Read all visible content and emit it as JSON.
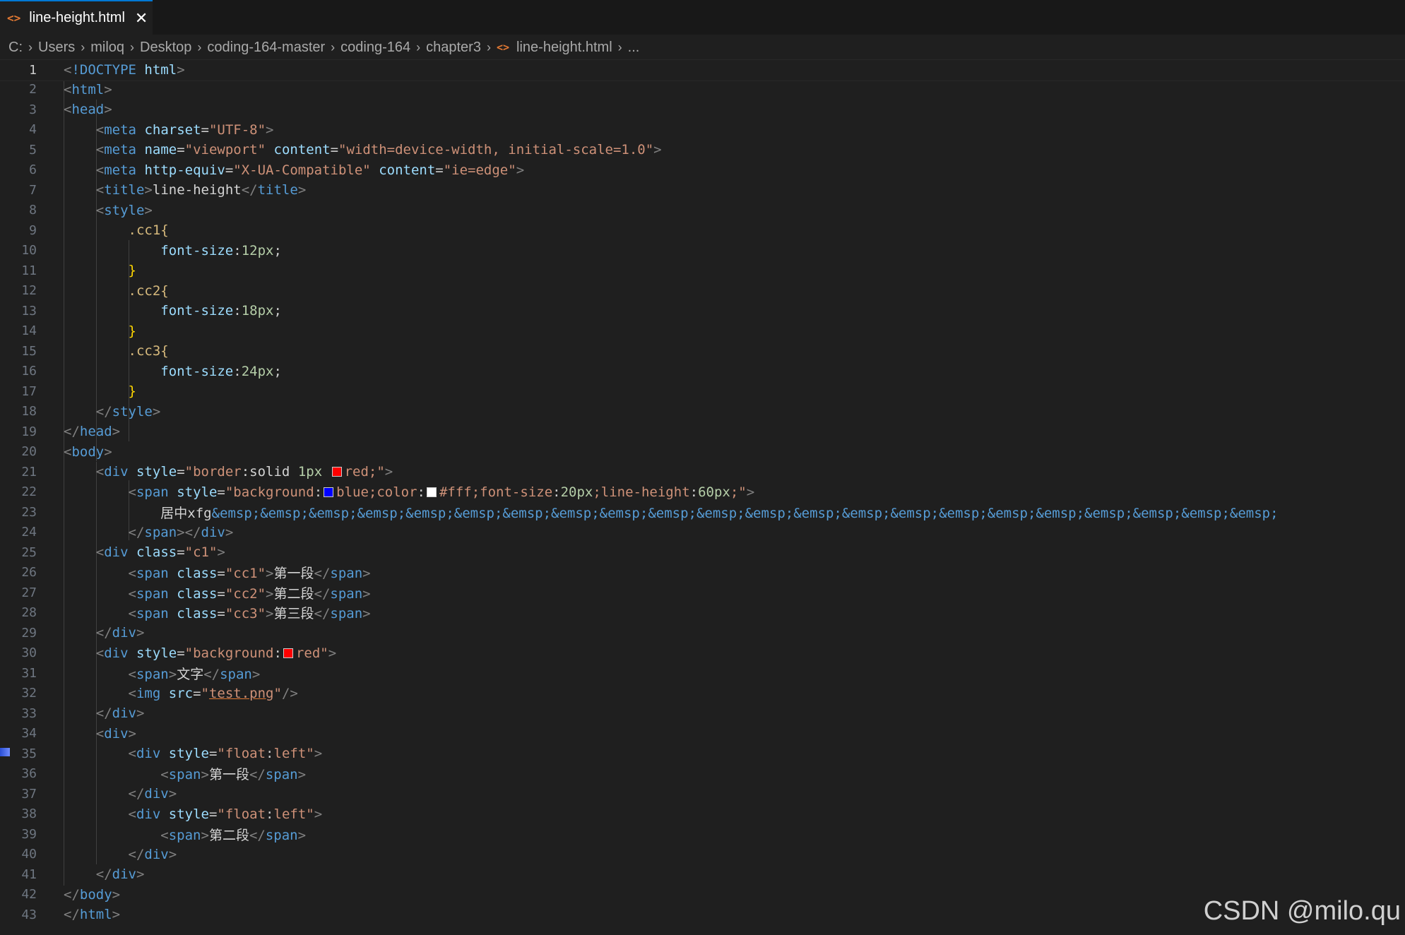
{
  "tab": {
    "icon": "html-file-icon",
    "label": "line-height.html",
    "close": "✕"
  },
  "breadcrumb": [
    "C:",
    "Users",
    "miloq",
    "Desktop",
    "coding-164-master",
    "coding-164",
    "chapter3",
    "line-height.html",
    "..."
  ],
  "colors": {
    "accent": "#0078d4",
    "html_icon": "#e37933",
    "swatch_red": "#ff0000",
    "swatch_blue": "#0000ff",
    "swatch_white": "#ffffff"
  },
  "editor": {
    "active_line": 1,
    "line_numbers": [
      "1",
      "2",
      "3",
      "4",
      "5",
      "6",
      "7",
      "8",
      "9",
      "10",
      "11",
      "12",
      "13",
      "14",
      "15",
      "16",
      "17",
      "18",
      "19",
      "20",
      "21",
      "22",
      "23",
      "24",
      "25",
      "26",
      "27",
      "28",
      "29",
      "30",
      "31",
      "32",
      "33",
      "34",
      "35",
      "36",
      "37",
      "38",
      "39",
      "40",
      "41",
      "42",
      "43"
    ],
    "code": {
      "doctype": "!DOCTYPE",
      "html": "html",
      "head": "head",
      "meta": "meta",
      "title": "title",
      "style": "style",
      "body": "body",
      "div": "div",
      "span": "span",
      "img": "img",
      "charset": "charset",
      "name": "name",
      "content": "content",
      "http_equiv": "http-equiv",
      "style_attr": "style",
      "class_attr": "class",
      "src": "src",
      "utf8": "\"UTF-8\"",
      "viewport": "\"viewport\"",
      "viewport_content": "\"width=device-width, initial-scale=1.0\"",
      "xua": "\"X-UA-Compatible\"",
      "ieedge": "\"ie=edge\"",
      "title_text": "line-height",
      "cc1": ".cc1{",
      "cc2": ".cc2{",
      "cc3": ".cc3{",
      "fs_prop": "font-size",
      "fs12": "12px",
      "fs18": "18px",
      "fs24": "24px",
      "close_brace": "}",
      "l21_a": "\"border",
      "l21_b": ":solid ",
      "l21_c": "1px",
      "l21_d": "red;\"",
      "l22_a": "\"background",
      "l22_b": "blue;color",
      "l22_c": "#fff;font-size",
      "l22_d": "20px",
      "l22_e": ";line-height",
      "l22_f": "60px",
      "l22_g": ";\"",
      "l23_text": "居中xfg",
      "l23_ent": "&emsp;&emsp;&emsp;&emsp;&emsp;&emsp;&emsp;&emsp;&emsp;&emsp;&emsp;&emsp;&emsp;&emsp;&emsp;&emsp;&emsp;&emsp;&emsp;&emsp;&emsp;&emsp;",
      "c1": "\"c1\"",
      "cc1v": "\"cc1\"",
      "cc2v": "\"cc2\"",
      "cc3v": "\"cc3\"",
      "seg1": "第一段",
      "seg2": "第二段",
      "seg3": "第三段",
      "l30_a": "\"background",
      "l30_b": "red\"",
      "wenzi": "文字",
      "testpng": "test.png",
      "float_a": "\"float",
      "float_b": "left\""
    }
  },
  "watermark": "CSDN @milo.qu"
}
